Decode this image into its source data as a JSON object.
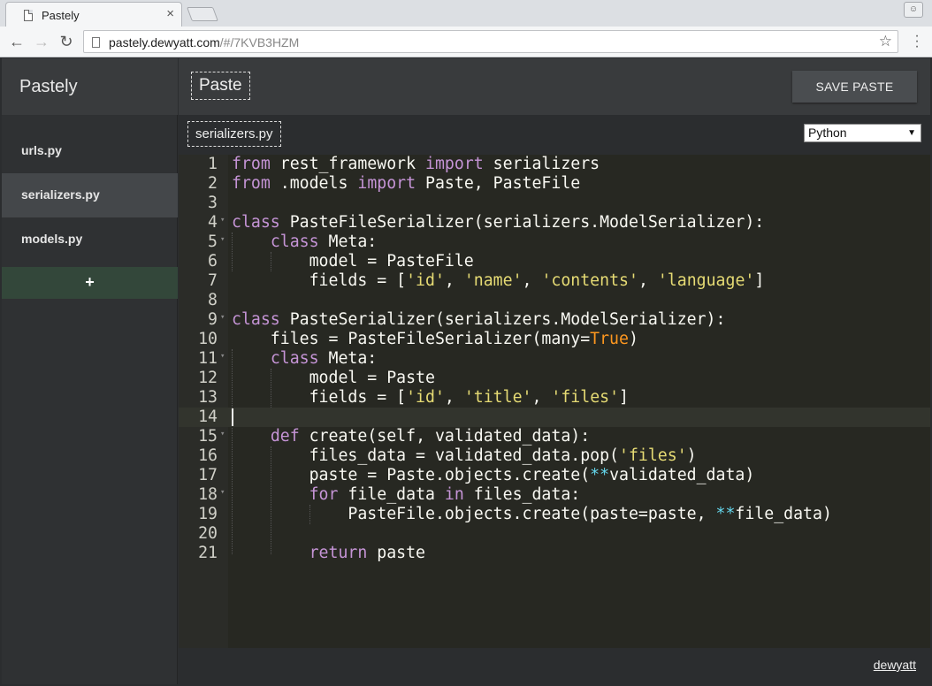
{
  "browser": {
    "tab_title": "Pastely",
    "tab_close": "×",
    "url_host": "pastely.dewyatt.com",
    "url_path": "/#/7KVB3HZM",
    "back": "←",
    "forward": "→",
    "reload": "↻",
    "star": "☆",
    "menu": "⋮"
  },
  "sidebar": {
    "brand": "Pastely",
    "files": [
      {
        "label": "urls.py"
      },
      {
        "label": "serializers.py"
      },
      {
        "label": "models.py"
      }
    ],
    "add_label": "+"
  },
  "header": {
    "paste_title": "Paste",
    "save_label": "SAVE PASTE"
  },
  "file": {
    "name": "serializers.py",
    "language": "Python"
  },
  "editor": {
    "line_numbers": [
      "1",
      "2",
      "3",
      "4",
      "5",
      "6",
      "7",
      "8",
      "9",
      "10",
      "11",
      "12",
      "13",
      "14",
      "15",
      "16",
      "17",
      "18",
      "19",
      "20",
      "21"
    ],
    "current_line": 14
  },
  "footer": {
    "user": "dewyatt"
  },
  "colors": {
    "editor_bg": "#272822",
    "keyword": "#c594d6",
    "string": "#e6db74",
    "constant": "#fd971f",
    "add_button_bg": "#33473a"
  }
}
